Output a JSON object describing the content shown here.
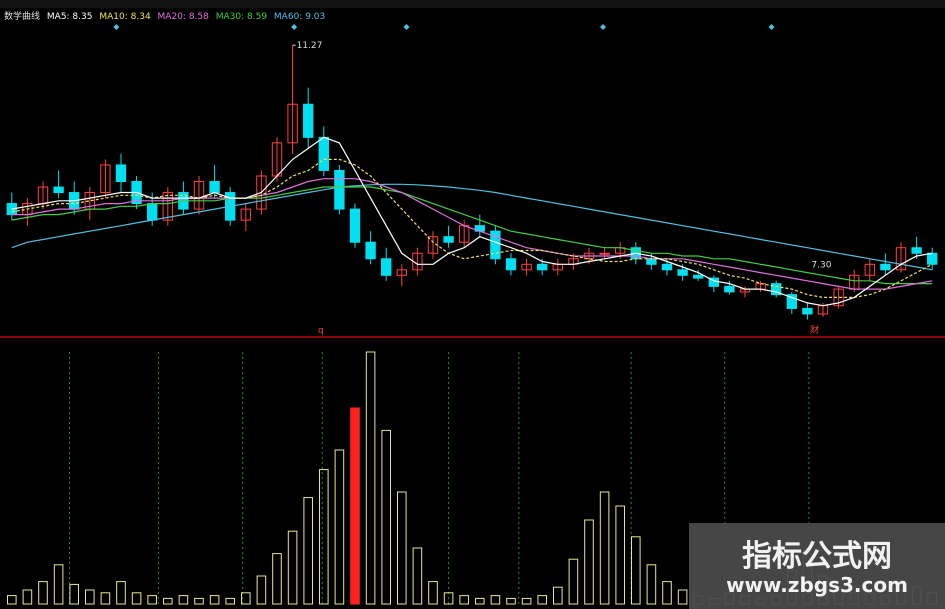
{
  "legend": {
    "label": "数学曲线",
    "ma5": "MA5: 8.35",
    "ma10": "MA10: 8.34",
    "ma20": "MA20: 8.58",
    "ma30": "MA30: 8.59",
    "ma60": "MA60: 9.03"
  },
  "colors": {
    "background": "#000000",
    "candle_up": "#ff4040",
    "candle_down": "#00e0f0",
    "ma5": "#ffffff",
    "ma10": "#f0e060",
    "ma20": "#e070e0",
    "ma30": "#40d040",
    "ma60": "#50c0e0",
    "volume": "#e8e890",
    "volume_highlight": "#ff2020",
    "divider": "#8b0000",
    "vertical_markers": "#2a8a2a"
  },
  "annotations": {
    "high_label": "11.27",
    "low_label": "7.30",
    "marker_q": "q",
    "marker_zhu": "财"
  },
  "watermark": {
    "title": "指标公式网",
    "url": "www.zbgs3.com"
  },
  "chart_data": {
    "type": "candlestick_with_volume",
    "price_series_high": 11.27,
    "price_series_low": 7.3,
    "candles": [
      [
        8.4,
        8.6,
        8.1,
        8.2
      ],
      [
        8.2,
        8.5,
        8.0,
        8.4
      ],
      [
        8.4,
        8.8,
        8.3,
        8.7
      ],
      [
        8.7,
        9.0,
        8.5,
        8.6
      ],
      [
        8.6,
        8.8,
        8.2,
        8.3
      ],
      [
        8.3,
        8.7,
        8.1,
        8.6
      ],
      [
        8.6,
        9.2,
        8.5,
        9.1
      ],
      [
        9.1,
        9.3,
        8.6,
        8.8
      ],
      [
        8.8,
        8.9,
        8.3,
        8.4
      ],
      [
        8.4,
        8.6,
        8.0,
        8.1
      ],
      [
        8.1,
        8.7,
        8.0,
        8.6
      ],
      [
        8.6,
        8.8,
        8.2,
        8.3
      ],
      [
        8.3,
        8.9,
        8.2,
        8.8
      ],
      [
        8.8,
        9.1,
        8.5,
        8.6
      ],
      [
        8.6,
        8.7,
        8.0,
        8.1
      ],
      [
        8.1,
        8.4,
        7.9,
        8.3
      ],
      [
        8.3,
        9.0,
        8.2,
        8.9
      ],
      [
        8.9,
        9.6,
        8.8,
        9.5
      ],
      [
        9.5,
        11.27,
        9.3,
        10.2
      ],
      [
        10.2,
        10.5,
        9.4,
        9.6
      ],
      [
        9.6,
        9.8,
        8.9,
        9.0
      ],
      [
        9.0,
        9.1,
        8.2,
        8.3
      ],
      [
        8.3,
        8.4,
        7.6,
        7.7
      ],
      [
        7.7,
        7.9,
        7.3,
        7.4
      ],
      [
        7.4,
        7.6,
        7.0,
        7.1
      ],
      [
        7.1,
        7.3,
        6.9,
        7.2
      ],
      [
        7.2,
        7.6,
        7.1,
        7.5
      ],
      [
        7.5,
        7.9,
        7.4,
        7.8
      ],
      [
        7.8,
        8.0,
        7.6,
        7.7
      ],
      [
        7.7,
        8.1,
        7.6,
        8.0
      ],
      [
        8.0,
        8.2,
        7.8,
        7.9
      ],
      [
        7.9,
        8.0,
        7.3,
        7.4
      ],
      [
        7.4,
        7.5,
        7.1,
        7.2
      ],
      [
        7.2,
        7.4,
        7.1,
        7.3
      ],
      [
        7.3,
        7.4,
        7.1,
        7.2
      ],
      [
        7.2,
        7.4,
        7.1,
        7.3
      ],
      [
        7.3,
        7.5,
        7.2,
        7.4
      ],
      [
        7.4,
        7.6,
        7.3,
        7.5
      ],
      [
        7.5,
        7.6,
        7.4,
        7.5
      ],
      [
        7.5,
        7.7,
        7.4,
        7.6
      ],
      [
        7.6,
        7.7,
        7.3,
        7.4
      ],
      [
        7.4,
        7.5,
        7.2,
        7.3
      ],
      [
        7.3,
        7.4,
        7.1,
        7.2
      ],
      [
        7.2,
        7.3,
        7.0,
        7.1
      ],
      [
        7.1,
        7.2,
        7.0,
        7.05
      ],
      [
        7.05,
        7.1,
        6.8,
        6.9
      ],
      [
        6.9,
        7.0,
        6.75,
        6.8
      ],
      [
        6.8,
        6.9,
        6.7,
        6.85
      ],
      [
        6.85,
        7.0,
        6.8,
        6.95
      ],
      [
        6.95,
        7.0,
        6.7,
        6.75
      ],
      [
        6.75,
        6.8,
        6.4,
        6.5
      ],
      [
        6.5,
        6.6,
        6.3,
        6.4
      ],
      [
        6.4,
        6.6,
        6.35,
        6.55
      ],
      [
        6.55,
        6.9,
        6.5,
        6.85
      ],
      [
        6.85,
        7.2,
        6.8,
        7.1
      ],
      [
        7.1,
        7.4,
        7.0,
        7.3
      ],
      [
        7.3,
        7.5,
        7.1,
        7.2
      ],
      [
        7.2,
        7.7,
        7.15,
        7.6
      ],
      [
        7.6,
        7.8,
        7.4,
        7.5
      ],
      [
        7.5,
        7.6,
        7.2,
        7.3
      ]
    ],
    "ma5": [
      8.3,
      8.35,
      8.4,
      8.45,
      8.45,
      8.5,
      8.55,
      8.6,
      8.6,
      8.5,
      8.5,
      8.5,
      8.5,
      8.6,
      8.5,
      8.5,
      8.6,
      8.9,
      9.2,
      9.4,
      9.6,
      9.5,
      9.0,
      8.5,
      8.0,
      7.5,
      7.3,
      7.3,
      7.5,
      7.6,
      7.8,
      7.7,
      7.6,
      7.5,
      7.35,
      7.3,
      7.3,
      7.35,
      7.4,
      7.45,
      7.5,
      7.45,
      7.35,
      7.25,
      7.15,
      7.0,
      6.95,
      6.85,
      6.85,
      6.8,
      6.7,
      6.6,
      6.55,
      6.6,
      6.7,
      6.9,
      7.1,
      7.3,
      7.45,
      7.5
    ],
    "ma10": [
      8.25,
      8.3,
      8.35,
      8.4,
      8.4,
      8.45,
      8.5,
      8.55,
      8.55,
      8.5,
      8.55,
      8.55,
      8.5,
      8.55,
      8.5,
      8.5,
      8.55,
      8.7,
      8.9,
      9.0,
      9.2,
      9.2,
      9.1,
      8.9,
      8.6,
      8.3,
      8.0,
      7.7,
      7.5,
      7.4,
      7.45,
      7.5,
      7.55,
      7.55,
      7.55,
      7.5,
      7.45,
      7.4,
      7.35,
      7.35,
      7.4,
      7.4,
      7.4,
      7.35,
      7.3,
      7.2,
      7.1,
      7.05,
      6.95,
      6.9,
      6.85,
      6.75,
      6.7,
      6.7,
      6.7,
      6.75,
      6.85,
      7.0,
      7.15,
      7.3
    ],
    "ma20": [
      8.2,
      8.2,
      8.25,
      8.3,
      8.3,
      8.35,
      8.4,
      8.4,
      8.45,
      8.45,
      8.45,
      8.5,
      8.5,
      8.5,
      8.5,
      8.5,
      8.55,
      8.6,
      8.7,
      8.8,
      8.85,
      8.85,
      8.85,
      8.8,
      8.7,
      8.6,
      8.45,
      8.3,
      8.15,
      8.0,
      7.9,
      7.8,
      7.7,
      7.6,
      7.55,
      7.5,
      7.45,
      7.45,
      7.45,
      7.45,
      7.45,
      7.4,
      7.4,
      7.4,
      7.35,
      7.3,
      7.25,
      7.2,
      7.15,
      7.1,
      7.05,
      7.0,
      6.95,
      6.9,
      6.85,
      6.85,
      6.85,
      6.9,
      6.95,
      7.0
    ],
    "ma30": [
      8.1,
      8.15,
      8.2,
      8.2,
      8.25,
      8.3,
      8.3,
      8.35,
      8.35,
      8.4,
      8.4,
      8.45,
      8.45,
      8.45,
      8.5,
      8.5,
      8.5,
      8.55,
      8.6,
      8.65,
      8.7,
      8.7,
      8.7,
      8.7,
      8.65,
      8.6,
      8.5,
      8.4,
      8.3,
      8.2,
      8.1,
      8.0,
      7.9,
      7.85,
      7.8,
      7.75,
      7.7,
      7.65,
      7.6,
      7.6,
      7.55,
      7.5,
      7.5,
      7.45,
      7.45,
      7.4,
      7.4,
      7.35,
      7.3,
      7.25,
      7.2,
      7.15,
      7.1,
      7.05,
      7.0,
      7.0,
      6.95,
      6.95,
      6.95,
      6.95
    ],
    "ma60": [
      7.6,
      7.7,
      7.75,
      7.8,
      7.85,
      7.9,
      7.95,
      8.0,
      8.05,
      8.1,
      8.15,
      8.2,
      8.25,
      8.3,
      8.35,
      8.4,
      8.45,
      8.5,
      8.55,
      8.6,
      8.65,
      8.7,
      8.72,
      8.74,
      8.75,
      8.75,
      8.74,
      8.72,
      8.7,
      8.67,
      8.64,
      8.6,
      8.55,
      8.5,
      8.45,
      8.4,
      8.35,
      8.3,
      8.25,
      8.2,
      8.15,
      8.1,
      8.05,
      8.0,
      7.95,
      7.9,
      7.85,
      7.8,
      7.75,
      7.7,
      7.65,
      7.6,
      7.55,
      7.5,
      7.45,
      7.4,
      7.35,
      7.3,
      7.25,
      7.2
    ],
    "volume": [
      3,
      5,
      8,
      14,
      7,
      5,
      4,
      8,
      4,
      3,
      2,
      3,
      2,
      3,
      2,
      4,
      10,
      18,
      26,
      38,
      48,
      55,
      70,
      90,
      62,
      40,
      20,
      8,
      4,
      3,
      2,
      3,
      2,
      2,
      3,
      6,
      16,
      30,
      40,
      35,
      24,
      14,
      8,
      5,
      3,
      2,
      4,
      3,
      2,
      3,
      12,
      18,
      10,
      6,
      4,
      4,
      3,
      5,
      6,
      4
    ],
    "volume_highlight_index": 22,
    "marker_high_index": 18,
    "marker_low_index": 51
  }
}
